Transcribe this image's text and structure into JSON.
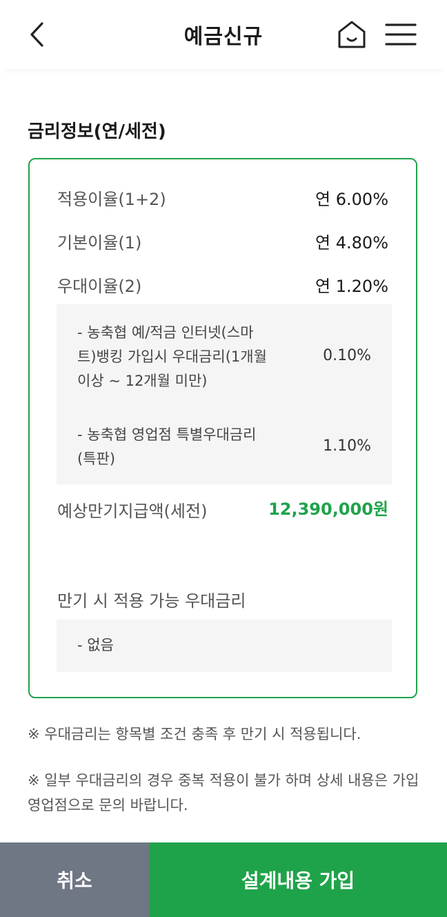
{
  "header": {
    "title": "예금신규"
  },
  "section_title": "금리정보(연/세전)",
  "rates": {
    "applied": {
      "label": "적용이율(1+2)",
      "value": "연 6.00%"
    },
    "base": {
      "label": "기본이율(1)",
      "value": "연 4.80%"
    },
    "preferential": {
      "label": "우대이율(2)",
      "value": "연 1.20%"
    },
    "preferential_items": [
      {
        "label": "- 농축협 예/적금 인터넷(스마트)뱅킹 가입시 우대금리(1개월 이상 ~ 12개월 미만)",
        "value": "0.10%"
      },
      {
        "label": "- 농축협 영업점 특별우대금리(특판)",
        "value": "1.10%"
      }
    ],
    "maturity": {
      "label": "예상만기지급액(세전)",
      "value": "12,390,000원"
    },
    "maturity_pref": {
      "label": "만기 시 적용 가능 우대금리",
      "item": "- 없음"
    }
  },
  "notices": [
    "※ 우대금리는 항목별 조건 충족 후 만기 시 적용됩니다.",
    "※ 일부 우대금리의 경우 중복 적용이 불가 하며 상세 내용은 가입 영업점으로 문의 바랍니다."
  ],
  "buttons": {
    "cancel": "취소",
    "join": "설계내용 가입"
  }
}
